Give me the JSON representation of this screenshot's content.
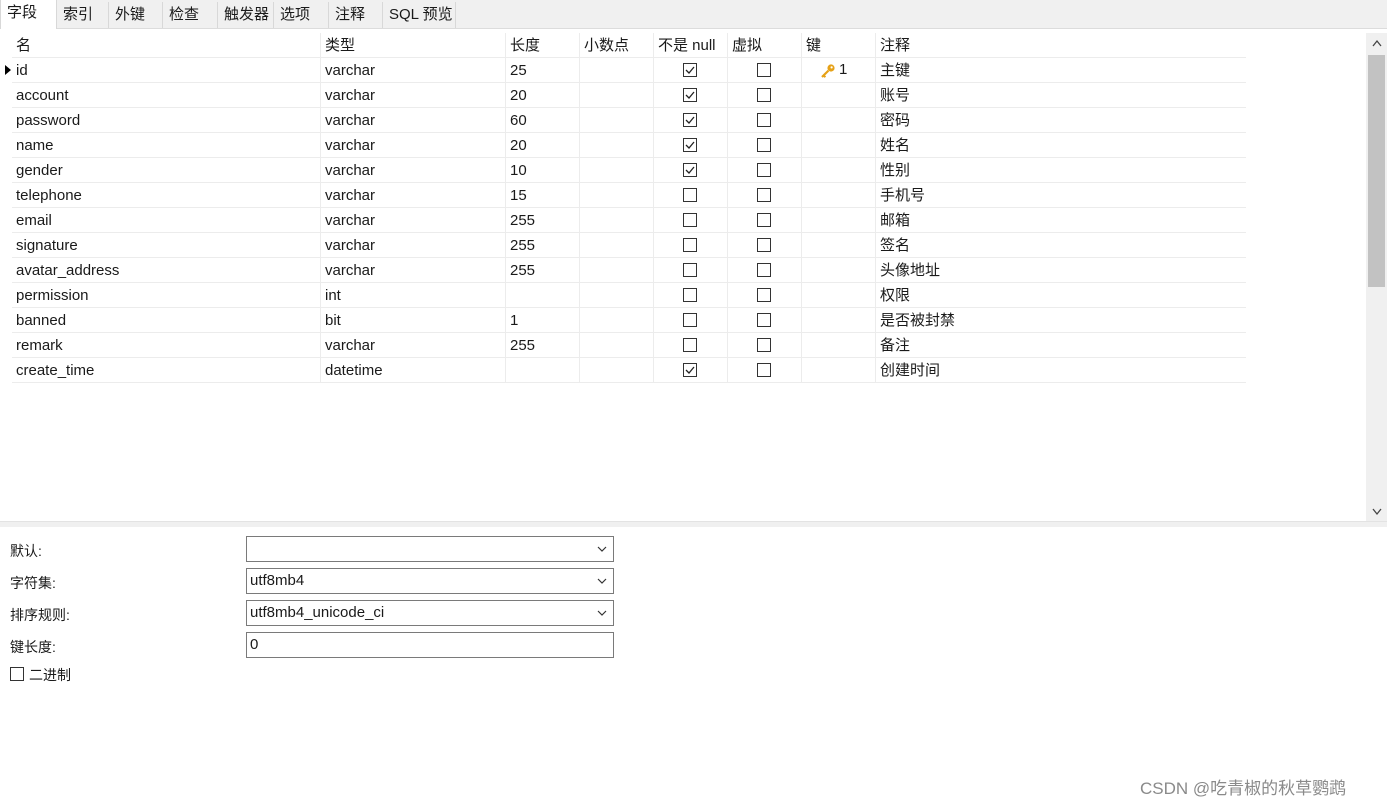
{
  "tabs": [
    {
      "label": "字段",
      "active": true
    },
    {
      "label": "索引"
    },
    {
      "label": "外键"
    },
    {
      "label": "检查"
    },
    {
      "label": "触发器"
    },
    {
      "label": "选项"
    },
    {
      "label": "注释"
    },
    {
      "label": "SQL 预览"
    }
  ],
  "grid": {
    "headers": {
      "name": "名",
      "type": "类型",
      "length": "长度",
      "decimals": "小数点",
      "not_null": "不是 null",
      "virtual": "虚拟",
      "key": "键",
      "comment": "注释"
    },
    "rows": [
      {
        "name": "id",
        "type": "varchar",
        "length": "25",
        "decimals": "",
        "not_null": true,
        "virtual": false,
        "key": "1",
        "comment": "主键"
      },
      {
        "name": "account",
        "type": "varchar",
        "length": "20",
        "decimals": "",
        "not_null": true,
        "virtual": false,
        "key": "",
        "comment": "账号"
      },
      {
        "name": "password",
        "type": "varchar",
        "length": "60",
        "decimals": "",
        "not_null": true,
        "virtual": false,
        "key": "",
        "comment": "密码"
      },
      {
        "name": "name",
        "type": "varchar",
        "length": "20",
        "decimals": "",
        "not_null": true,
        "virtual": false,
        "key": "",
        "comment": "姓名"
      },
      {
        "name": "gender",
        "type": "varchar",
        "length": "10",
        "decimals": "",
        "not_null": true,
        "virtual": false,
        "key": "",
        "comment": "性别"
      },
      {
        "name": "telephone",
        "type": "varchar",
        "length": "15",
        "decimals": "",
        "not_null": false,
        "virtual": false,
        "key": "",
        "comment": "手机号"
      },
      {
        "name": "email",
        "type": "varchar",
        "length": "255",
        "decimals": "",
        "not_null": false,
        "virtual": false,
        "key": "",
        "comment": "邮箱"
      },
      {
        "name": "signature",
        "type": "varchar",
        "length": "255",
        "decimals": "",
        "not_null": false,
        "virtual": false,
        "key": "",
        "comment": "签名"
      },
      {
        "name": "avatar_address",
        "type": "varchar",
        "length": "255",
        "decimals": "",
        "not_null": false,
        "virtual": false,
        "key": "",
        "comment": "头像地址"
      },
      {
        "name": "permission",
        "type": "int",
        "length": "",
        "decimals": "",
        "not_null": false,
        "virtual": false,
        "key": "",
        "comment": "权限"
      },
      {
        "name": "banned",
        "type": "bit",
        "length": "1",
        "decimals": "",
        "not_null": false,
        "virtual": false,
        "key": "",
        "comment": "是否被封禁"
      },
      {
        "name": "remark",
        "type": "varchar",
        "length": "255",
        "decimals": "",
        "not_null": false,
        "virtual": false,
        "key": "",
        "comment": "备注"
      },
      {
        "name": "create_time",
        "type": "datetime",
        "length": "",
        "decimals": "",
        "not_null": true,
        "virtual": false,
        "key": "",
        "comment": "创建时间"
      }
    ]
  },
  "properties": {
    "default_label": "默认:",
    "default_value": "",
    "charset_label": "字符集:",
    "charset_value": "utf8mb4",
    "collation_label": "排序规则:",
    "collation_value": "utf8mb4_unicode_ci",
    "key_length_label": "键长度:",
    "key_length_value": "0",
    "binary_label": "二进制",
    "binary_checked": false
  },
  "watermark": "CSDN @吃青椒的秋草鹦鹉",
  "icons": {
    "row_marker": "row-pointer-icon",
    "key": "key-icon",
    "dropdown": "chevron-down-icon"
  },
  "colors": {
    "key_icon": "#e6a117"
  }
}
